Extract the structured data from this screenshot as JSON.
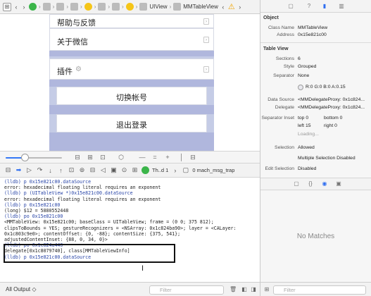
{
  "jumpbar": {
    "crumbs": [
      "UIView",
      "MMTableView"
    ]
  },
  "canvas": {
    "rows": [
      {
        "label": "帮助与反馈"
      },
      {
        "label": "关于微信"
      },
      {
        "label": "插件"
      }
    ],
    "switch_account": "切换帐号",
    "logout": "退出登录"
  },
  "debugbar": {
    "thread": "Th..d 1",
    "frame": "0 mach_msg_trap"
  },
  "console": {
    "lines": [
      "(lldb) p 0x15e821c00.dataSource",
      "error: hexadecimal floating literal requires an exponent",
      "(lldb) p (UITableView *)0x15e821c00.dataSource",
      "error: hexadecimal floating literal requires an exponent",
      "(lldb) p 0x15e821c00",
      "(long) $12 = 5880552448",
      "(lldb) po 0x15e821c00",
      "<MMTableView: 0x15e821c00; baseClass = UITableView; frame = (0 0; 375 812);",
      "clipsToBounds = YES; gestureRecognizers = <NSArray: 0x1c824ba90>; layer = <CALayer:",
      "0x1c803c9e0>; contentOffset: {0, -88}; contentSize: {375, 541};",
      "adjustedContentInset: {88, 0, 34, 0}>",
      "",
      "(lldb) po 0x1c824a440",
      "delegate[0x1c8079740], class[MMTableViewInfo]",
      "",
      "(lldb) p 0x15e821c00.dataSource"
    ]
  },
  "statusbar": {
    "output": "All Output ◇",
    "filter_placeholder": "Filter"
  },
  "inspector": {
    "object_title": "Object",
    "class_name_label": "Class Name",
    "class_name": "MMTableView",
    "address_label": "Address",
    "address": "0x15e821c00",
    "table_view_title": "Table View",
    "sections_label": "Sections",
    "sections": "6",
    "style_label": "Style",
    "style": "Grouped",
    "separator_label": "Separator",
    "separator": "None",
    "separator_color": "R:0 G:0 B:0 A:0.15",
    "datasource_label": "Data Source",
    "datasource": "<MMDelegateProxy: 0x1c824...",
    "delegate_label": "Delegate",
    "delegate": "<MMDelegateProxy: 0x1c824...",
    "sep_inset_label": "Separator Inset",
    "inset_top": "top 0",
    "inset_bottom": "bottom 0",
    "inset_left": "left 15",
    "inset_right": "right 0",
    "loading": "Loading...",
    "selection_label": "Selection",
    "selection": "Allowed",
    "multi_selection": "Multiple Selection Disabled",
    "edit_selection_label": "Edit Selection",
    "edit_selection": "Disabled",
    "no_matches": "No Matches",
    "filter_placeholder": "Filter"
  }
}
